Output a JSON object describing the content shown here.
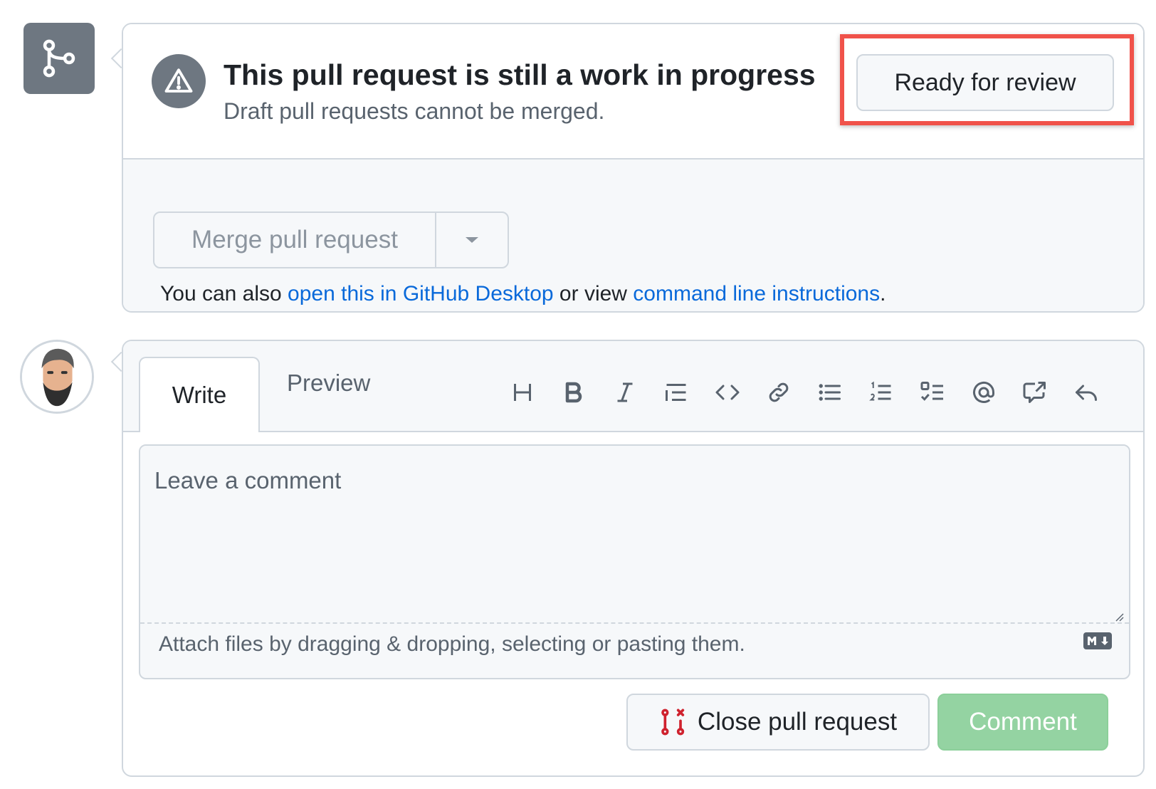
{
  "merge_status": {
    "title": "This pull request is still a work in progress",
    "subtitle": "Draft pull requests cannot be merged.",
    "ready_button_label": "Ready for review",
    "merge_button_label": "Merge pull request",
    "also_prefix": "You can also ",
    "desktop_link": "open this in GitHub Desktop",
    "middle_text": " or view ",
    "cli_link": "command line instructions",
    "suffix": "."
  },
  "comment_form": {
    "tabs": [
      "Write",
      "Preview"
    ],
    "active_tab": "Write",
    "toolbar_icons": [
      "heading-icon",
      "bold-icon",
      "italic-icon",
      "quote-icon",
      "code-icon",
      "link-icon",
      "unordered-list-icon",
      "ordered-list-icon",
      "task-list-icon",
      "mention-icon",
      "cross-reference-icon",
      "reply-icon"
    ],
    "placeholder": "Leave a comment",
    "value": "",
    "attach_text": "Attach files by dragging & dropping, selecting or pasting them.",
    "close_button_label": "Close pull request",
    "comment_button_label": "Comment"
  },
  "colors": {
    "link": "#0969da",
    "highlight": "#f0524a",
    "comment_button": "#94d3a2",
    "close_icon": "#cf222e",
    "badge": "#6e7781"
  }
}
